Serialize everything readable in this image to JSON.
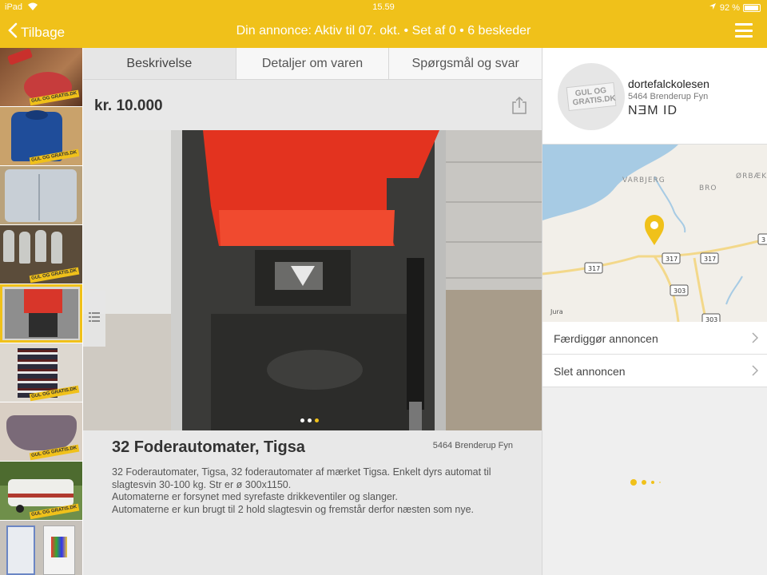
{
  "status": {
    "carrier": "iPad",
    "time": "15.59",
    "battery": "92 %"
  },
  "nav": {
    "back_label": "Tilbage",
    "title": "Din annonce: Aktiv til 07. okt. • Set af 0 • 6 beskeder"
  },
  "thumb_watermark": "GUL OG GRATIS.DK",
  "tabs": [
    "Beskrivelse",
    "Detaljer om varen",
    "Spørgsmål og svar"
  ],
  "listing": {
    "price": "kr. 10.000",
    "title": "32 Foderautomater, Tigsa",
    "location": "5464 Brenderup Fyn",
    "description": [
      "32 Foderautomater, Tigsa, 32 foderautomater af mærket Tigsa. Enkelt dyrs automat til",
      "slagtesvin 30-100 kg. Str er ø 300x1150.",
      "Automaterne er forsynet med syrefaste drikkeventiler og slanger.",
      "Automaterne er kun brugt til 2 hold slagtesvin og fremstår derfor næsten som nye."
    ]
  },
  "seller": {
    "avatar_text": "GUL OG GRATIS.DK",
    "username": "dortefalckolesen",
    "location": "5464 Brenderup Fyn",
    "nemid": "NƎM ID"
  },
  "map": {
    "places": [
      "VARBJERG",
      "BRO",
      "ØRBÆK",
      "Jura"
    ],
    "roads": [
      "317",
      "317",
      "317",
      "303",
      "303",
      "3"
    ]
  },
  "actions": [
    "Færdiggør annoncen",
    "Slet annoncen"
  ],
  "colors": {
    "brand": "#f0c11a",
    "background": "#ececec"
  }
}
